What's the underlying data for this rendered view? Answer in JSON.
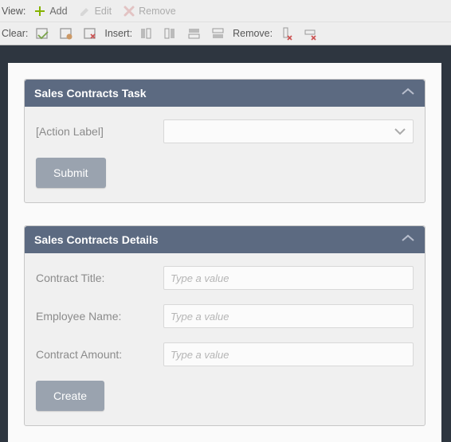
{
  "toolbar": {
    "view_label": "View:",
    "add": "Add",
    "edit": "Edit",
    "remove": "Remove",
    "clear_label": "Clear:",
    "insert_label": "Insert:",
    "remove_label": "Remove:"
  },
  "panels": {
    "task": {
      "title": "Sales Contracts Task",
      "action_label": "[Action Label]",
      "submit": "Submit"
    },
    "details": {
      "title": "Sales Contracts Details",
      "fields": {
        "contract_title": {
          "label": "Contract Title:",
          "placeholder": "Type a value"
        },
        "employee_name": {
          "label": "Employee Name:",
          "placeholder": "Type a value"
        },
        "contract_amount": {
          "label": "Contract Amount:",
          "placeholder": "Type a value"
        }
      },
      "create": "Create"
    }
  }
}
